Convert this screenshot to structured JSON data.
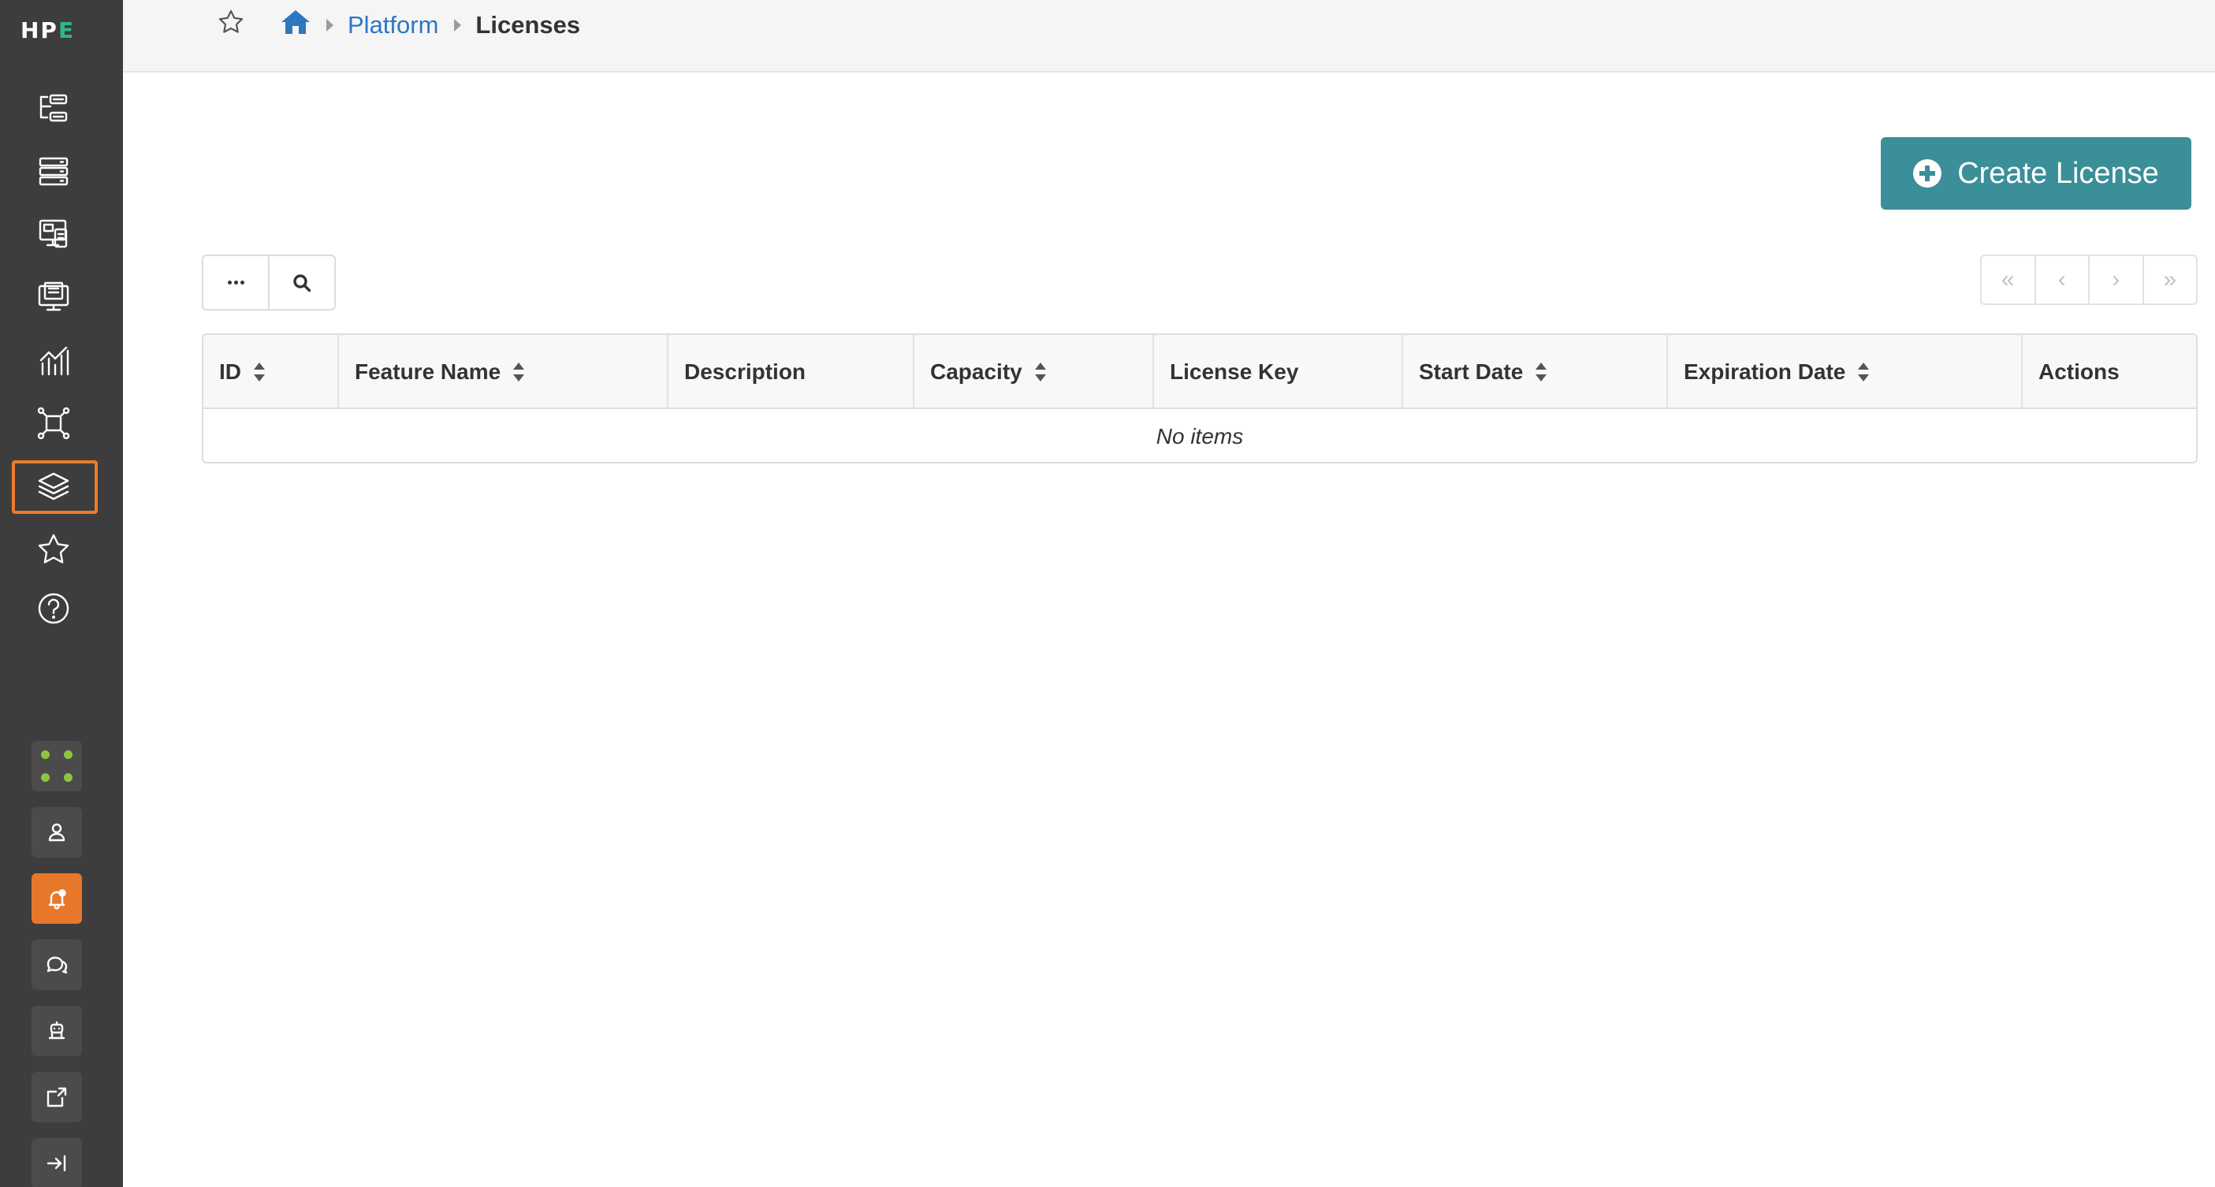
{
  "brand": {
    "logo_left": "HP",
    "logo_accent": "E",
    "accent_color": "#2fb58f"
  },
  "sidebar": {
    "nav": [
      {
        "icon": "hierarchy-icon",
        "label": ""
      },
      {
        "icon": "server-stack-icon",
        "label": ""
      },
      {
        "icon": "devices-icon",
        "label": ""
      },
      {
        "icon": "monitor-icon",
        "label": ""
      },
      {
        "icon": "analytics-chart-icon",
        "label": ""
      },
      {
        "icon": "network-topology-icon",
        "label": ""
      },
      {
        "icon": "layers-icon",
        "label": "",
        "active": true
      },
      {
        "icon": "star-icon",
        "label": ""
      },
      {
        "icon": "help-icon",
        "label": ""
      }
    ],
    "utilities": [
      {
        "icon": "apps-dots-icon"
      },
      {
        "icon": "user-icon"
      },
      {
        "icon": "bell-alert-icon",
        "color": "#e7782a"
      },
      {
        "icon": "chat-icon"
      },
      {
        "icon": "assistant-bot-icon"
      },
      {
        "icon": "external-doc-icon"
      },
      {
        "icon": "collapse-sidebar-icon"
      }
    ],
    "active_highlight_color": "#ea7d2c"
  },
  "breadcrumb": {
    "items": [
      {
        "label": "Platform",
        "link": true
      },
      {
        "label": "Licenses",
        "link": false
      }
    ],
    "link_color": "#2c77c0"
  },
  "actions": {
    "create_label": "Create License",
    "create_color": "#3a8f98"
  },
  "pager": {
    "first": "«",
    "prev": "‹",
    "next": "›",
    "last": "»"
  },
  "table": {
    "columns": [
      {
        "label": "ID",
        "sortable": true
      },
      {
        "label": "Feature Name",
        "sortable": true
      },
      {
        "label": "Description",
        "sortable": false
      },
      {
        "label": "Capacity",
        "sortable": true
      },
      {
        "label": "License Key",
        "sortable": false
      },
      {
        "label": "Start Date",
        "sortable": true
      },
      {
        "label": "Expiration Date",
        "sortable": true
      },
      {
        "label": "Actions",
        "sortable": false
      }
    ],
    "empty_text": "No items"
  }
}
